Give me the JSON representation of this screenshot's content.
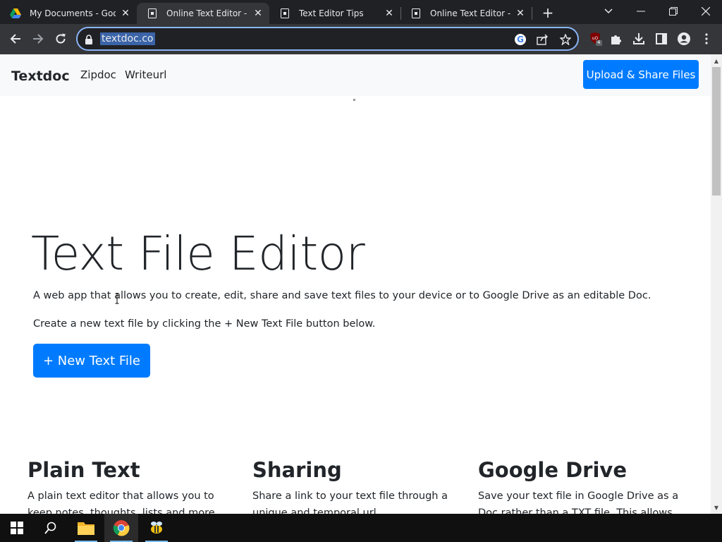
{
  "browser": {
    "tabs": [
      {
        "title": "My Documents - Goog",
        "icon": "google-drive-icon",
        "active": false
      },
      {
        "title": "Online Text Editor - Cr",
        "icon": "textdoc-favicon",
        "active": true
      },
      {
        "title": "Text Editor Tips",
        "icon": "textdoc-favicon",
        "active": false
      },
      {
        "title": "Online Text Editor - Cr",
        "icon": "textdoc-favicon",
        "active": false
      }
    ],
    "address": "textdoc.co",
    "extension_badge": "4"
  },
  "site": {
    "brand": "Textdoc",
    "nav_links": [
      "Zipdoc",
      "Writeurl"
    ],
    "upload_button": "Upload & Share Files"
  },
  "hero": {
    "title": "Text File Editor",
    "lead1": "A web app that allows you to create, edit, share and save text files to your device or to Google Drive as an editable Doc.",
    "lead2": "Create a new text file by clicking the + New Text File button below.",
    "button": "+ New Text File"
  },
  "features": [
    {
      "title": "Plain Text",
      "text": "A plain text editor that allows you to keep notes, thoughts, lists and more."
    },
    {
      "title": "Sharing",
      "text": "Share a link to your text file through a unique and temporal url..."
    },
    {
      "title": "Google Drive",
      "text": "Save your text file in Google Drive as a Doc rather than a TXT file. This allows..."
    }
  ],
  "colors": {
    "primary": "#007bff",
    "chrome_dark": "#202124",
    "chrome_toolbar": "#35363a",
    "omnibox_focus": "#8ab4f8"
  }
}
